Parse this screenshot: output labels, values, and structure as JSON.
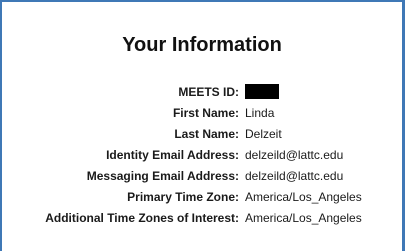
{
  "page": {
    "title": "Your Information"
  },
  "fields": [
    {
      "label": "MEETS ID:",
      "value": ""
    },
    {
      "label": "First Name:",
      "value": "Linda"
    },
    {
      "label": "Last Name:",
      "value": "Delzeit"
    },
    {
      "label": "Identity Email Address:",
      "value": "delzeild@lattc.edu"
    },
    {
      "label": "Messaging Email Address:",
      "value": "delzeild@lattc.edu"
    },
    {
      "label": "Primary Time Zone:",
      "value": "America/Los_Angeles"
    },
    {
      "label": "Additional Time Zones of Interest:",
      "value": "America/Los_Angeles"
    }
  ],
  "colors": {
    "frame_border": "#3f78b6",
    "redaction": "#000000"
  }
}
